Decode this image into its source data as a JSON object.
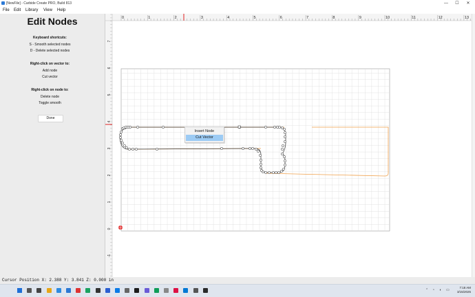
{
  "window": {
    "title": "[NewFile] - Carbide Create PRO, Build 813",
    "minimize_glyph": "—",
    "maximize_glyph": "☐",
    "close_glyph": "✕"
  },
  "menu": {
    "items": [
      "File",
      "Edit",
      "Library",
      "View",
      "Help"
    ]
  },
  "panel": {
    "title": "Edit Nodes",
    "sections": [
      {
        "heading": "Keyboard shortcuts:",
        "lines": [
          "S - Smooth selected nodes",
          "D - Delete selected nodes"
        ]
      },
      {
        "heading": "Right-click on vector to:",
        "lines": [
          "Add node",
          "Cut vector"
        ]
      },
      {
        "heading": "Right-click on node to:",
        "lines": [
          "Delete node",
          "Toggle smooth"
        ]
      }
    ],
    "done_label": "Done"
  },
  "ruler": {
    "x_labels": [
      "0",
      "1",
      "2",
      "3",
      "4",
      "5",
      "6",
      "7",
      "8",
      "9",
      "10",
      "11",
      "12",
      "13"
    ],
    "y_labels": [
      "7",
      "6",
      "5",
      "4",
      "3",
      "2",
      "1",
      "0",
      "-1"
    ]
  },
  "context_menu": {
    "items": [
      "Insert Node",
      "Cut Vector"
    ],
    "highlighted_index": 1
  },
  "status": {
    "text": "Cursor Position X: 2.388 Y: 3.841 Z: 0.000 in"
  },
  "taskbar": {
    "time": "7:18 AM",
    "date": "3/15/2025",
    "icons": [
      "windows-start-icon",
      "search-icon",
      "task-view-icon",
      "app-icon-1",
      "app-icon-2",
      "app-icon-3",
      "app-icon-4",
      "app-icon-5",
      "app-icon-6",
      "app-icon-7",
      "app-icon-8",
      "app-icon-9",
      "app-icon-10",
      "app-icon-11",
      "app-icon-12",
      "app-icon-13",
      "app-icon-14",
      "app-icon-15",
      "app-icon-16",
      "app-icon-17"
    ]
  },
  "colors": {
    "accent_red": "#e02020",
    "toolpath_orange": "#f0a04a",
    "highlight_blue": "#9ccbf4",
    "grid_line": "#dcdcdc"
  }
}
